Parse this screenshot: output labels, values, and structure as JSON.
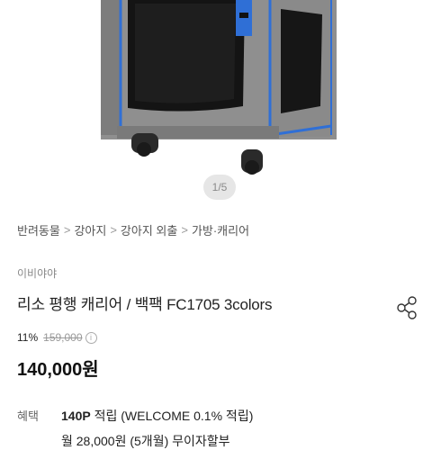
{
  "gallery": {
    "pager": "1/5"
  },
  "breadcrumb": {
    "items": [
      "반려동물",
      "강아지",
      "강아지 외출",
      "가방·캐리어"
    ],
    "separator": ">"
  },
  "product": {
    "brand": "이비야야",
    "title": "리소 평행 캐리어 / 백팩 FC1705 3colors",
    "discount": "11%",
    "original_price": "159,000",
    "info_icon": "i",
    "price": "140,000원"
  },
  "benefits": {
    "label": "혜택",
    "points": "140P",
    "points_text": "적립 (WELCOME 0.1% 적립)",
    "second_line": "월 28,000원 (5개월) 무이자할부"
  },
  "colors": {
    "carrier_gray": "#8f8f8f",
    "carrier_blue": "#2f6fd6",
    "text_primary": "#222222",
    "text_muted": "#888888"
  }
}
